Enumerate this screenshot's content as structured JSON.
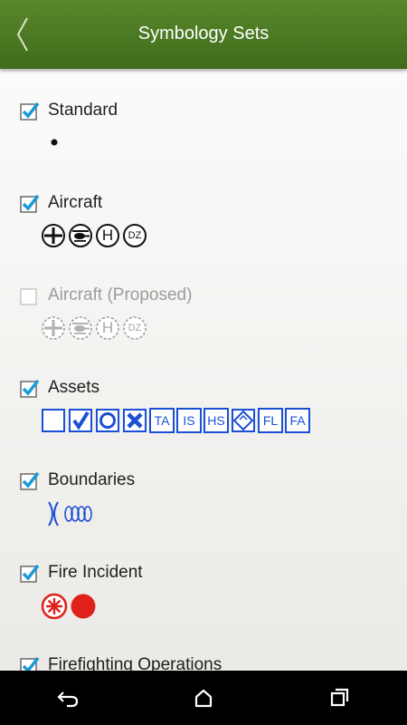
{
  "header": {
    "title": "Symbology Sets"
  },
  "colors": {
    "header": "#4b7a22",
    "check": "#1a9bd7",
    "asset_blue": "#1b4fd6",
    "fire_red": "#e0201a"
  },
  "sets": [
    {
      "label": "Standard",
      "checked": true,
      "enabled": true,
      "icons": [
        "dot-icon"
      ]
    },
    {
      "label": "Aircraft",
      "checked": true,
      "enabled": true,
      "icons": [
        "fixed-wing-icon",
        "helicopter-icon",
        "helipad-h-icon",
        "dz-icon"
      ]
    },
    {
      "label": "Aircraft (Proposed)",
      "checked": false,
      "enabled": false,
      "icons": [
        "fixed-wing-icon",
        "helicopter-icon",
        "helipad-h-icon",
        "dz-icon"
      ]
    },
    {
      "label": "Assets",
      "checked": true,
      "enabled": true,
      "icons": [
        "empty-square-icon",
        "check-square-icon",
        "circle-square-icon",
        "x-square-icon",
        "TA",
        "IS",
        "HS",
        "diamond-square-icon",
        "FL",
        "FA"
      ]
    },
    {
      "label": "Boundaries",
      "checked": true,
      "enabled": true,
      "icons": [
        "boundary-line-icon",
        "coil-icon"
      ]
    },
    {
      "label": "Fire Incident",
      "checked": true,
      "enabled": true,
      "icons": [
        "fire-origin-icon",
        "fire-dot-icon"
      ]
    },
    {
      "label": "Firefighting Operations",
      "checked": true,
      "enabled": true,
      "icons": []
    }
  ],
  "aircraft_badges": {
    "helipad": "H",
    "dz": "DZ"
  },
  "asset_badges": {
    "ta": "TA",
    "is": "IS",
    "hs": "HS",
    "fl": "FL",
    "fa": "FA"
  },
  "nav": {
    "icons": [
      "back-icon",
      "home-icon",
      "recents-icon"
    ]
  }
}
